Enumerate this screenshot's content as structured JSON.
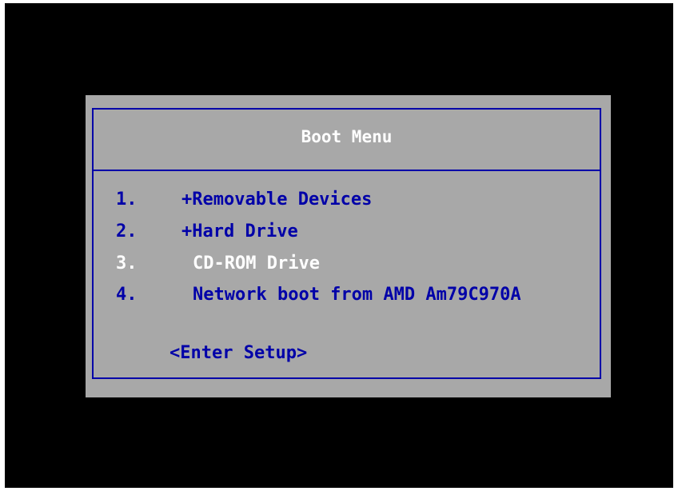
{
  "boot_menu": {
    "title": "Boot Menu",
    "items": [
      {
        "number": "1.",
        "label": "+Removable Devices"
      },
      {
        "number": "2.",
        "label": "+Hard Drive"
      },
      {
        "number": "3.",
        "label": "CD-ROM Drive"
      },
      {
        "number": "4.",
        "label": "Network boot from AMD Am79C970A"
      }
    ],
    "selected_index": 2,
    "setup_label": "<Enter Setup>"
  },
  "colors": {
    "screen_background": "#000000",
    "panel_background": "#a8a8a8",
    "text_blue": "#0000a8",
    "text_highlight": "#ffffff"
  }
}
